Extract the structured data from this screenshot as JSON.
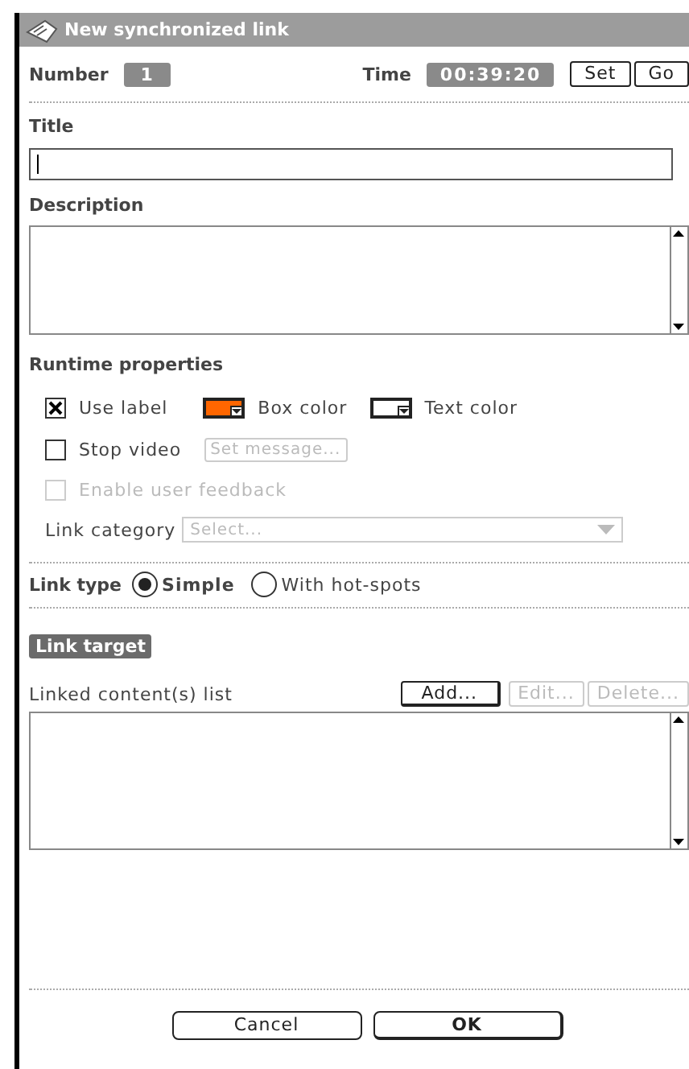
{
  "window": {
    "title": "New synchronized link"
  },
  "number": {
    "label": "Number",
    "value": "1"
  },
  "time": {
    "label": "Time",
    "value": "00:39:20"
  },
  "time_buttons": [
    {
      "label": "Set"
    },
    {
      "label": "Go"
    }
  ],
  "title_field": {
    "label": "Title",
    "focused": true
  },
  "description_field": {
    "label": "Description"
  },
  "runtime": {
    "heading": "Runtime properties",
    "use_label": {
      "label": "Use label",
      "checked": true
    },
    "colors": [
      {
        "label": "Box color",
        "color": "#ff6600"
      },
      {
        "label": "Text color",
        "color": "#ffffff"
      }
    ],
    "stop_video": {
      "label": "Stop video",
      "checked": false
    },
    "set_message_button": {
      "label": "Set message...",
      "disabled": true
    },
    "user_feedback": {
      "label": "Enable user feedback",
      "checked": false,
      "disabled": true
    },
    "link_category": {
      "label": "Link category",
      "placeholder": "Select...",
      "disabled": true
    }
  },
  "link_type": {
    "label": "Link type",
    "options": [
      {
        "label": "Simple",
        "selected": true
      },
      {
        "label": "With hot-spots",
        "selected": false
      }
    ]
  },
  "link_target": {
    "heading": "Link target",
    "list_label": "Linked content(s) list",
    "buttons": [
      {
        "label": "Add...",
        "disabled": false
      },
      {
        "label": "Edit...",
        "disabled": true
      },
      {
        "label": "Delete...",
        "disabled": true
      }
    ]
  },
  "footer_buttons": [
    {
      "label": "Cancel",
      "kind": "normal"
    },
    {
      "label": "OK",
      "kind": "default"
    }
  ]
}
